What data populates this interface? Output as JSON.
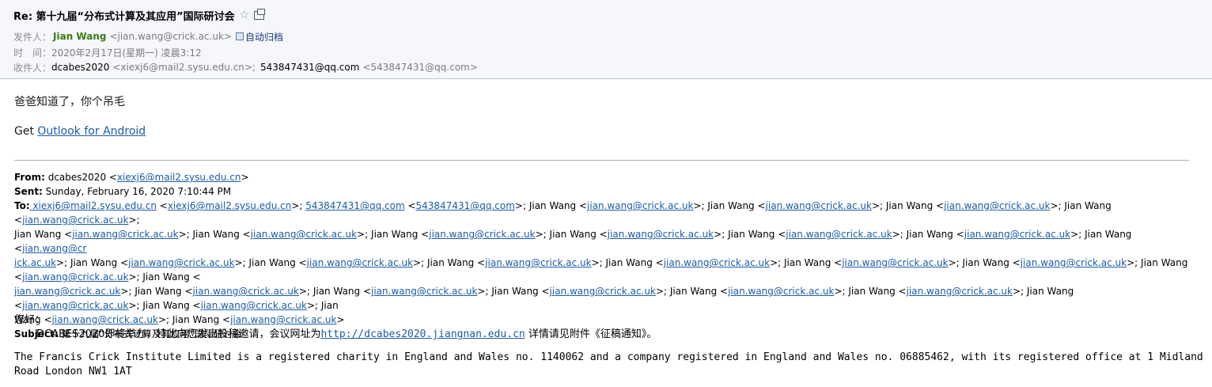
{
  "header": {
    "subject": "Re: 第十九届“分布式计算及其应用”国际研讨会",
    "star_glyph": "☆",
    "from_label": "发件人：",
    "from_name": "Jian Wang",
    "from_email": "<jian.wang@crick.ac.uk>",
    "archive_label": "自动归档",
    "time_label": "时　间：",
    "time_value": "2020年2月17日(星期一) 凌晨3:12",
    "to_label": "收件人：",
    "to_1_name": "dcabes2020",
    "to_1_email": "<xiexj6@mail2.sysu.edu.cn>;",
    "to_2_name": "543847431@qq.com",
    "to_2_email": "<543847431@qq.com>"
  },
  "body": {
    "line1": "爸爸知道了，你个吊毛",
    "get_prefix": "Get ",
    "get_link": "Outlook for Android"
  },
  "forwarded": {
    "from_label": "From:",
    "from_value_name": " dcabes2020 <",
    "from_value_email": "xiexj6@mail2.sysu.edu.cn",
    "from_value_end": ">",
    "sent_label": "Sent:",
    "sent_value": " Sunday, February 16, 2020 7:10:44 PM",
    "to_label": "To:",
    "to_segment_1": " xiexj6@mail2.sysu.edu.cn",
    "to_segment_2": " <",
    "to_segment_3": "xiexj6@mail2.sysu.edu.cn",
    "to_segment_4": ">; ",
    "to_segment_5": "543847431@qq.com",
    "to_segment_6": " <",
    "to_segment_7": "543847431@qq.com",
    "to_segment_8": ">; ",
    "jw_name": "Jian Wang <",
    "jw_email": "jian.wang@crick.ac.uk",
    "jw_end": ">; ",
    "jw_last_end": ">",
    "jw_split_a": "jian.wang@cr",
    "jw_split_b": "ick.ac.uk",
    "jw_name_a": "Jian",
    "jw_name_b": "Wang <",
    "subject_label": "Subject:",
    "subject_value": " 第十九届“分布式计算及其应用”国际研讨会"
  },
  "invitation": {
    "greeting": "您好：",
    "text_before": "DCABES2020即将举办，特此向您发出投稿邀请，会议网址为",
    "url": "http://dcabes2020.jiangnan.edu.cn",
    "text_after": " 详情请见附件《征稿通知》。"
  },
  "footer": {
    "text": "The Francis Crick Institute Limited is a registered charity in England and Wales no. 1140062 and a company registered in England and Wales no. 06885462, with its registered office at 1 Midland Road London NW1 1AT"
  },
  "colors": {
    "link": "#1b5ca7",
    "sender": "#3c7b17",
    "header_bg": "#f5f7fa"
  }
}
